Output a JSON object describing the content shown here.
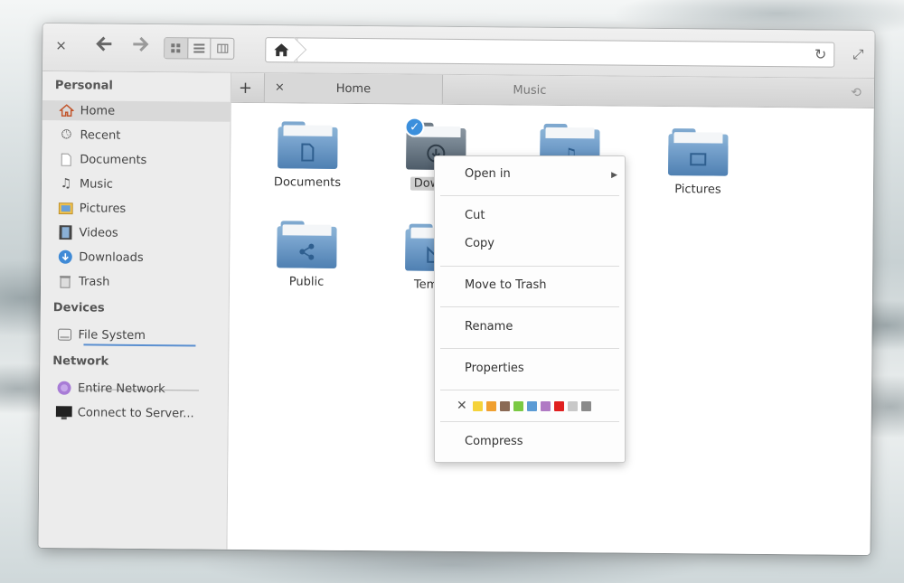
{
  "toolbar": {
    "close_glyph": "×",
    "back_glyph": "🡐",
    "forward_glyph": "🡒",
    "reload_glyph": "↻",
    "maximize_glyph": "⤢"
  },
  "sidebar": {
    "personal_heading": "Personal",
    "devices_heading": "Devices",
    "network_heading": "Network",
    "items": [
      {
        "label": "Home",
        "icon": "home-icon"
      },
      {
        "label": "Recent",
        "icon": "clock-icon"
      },
      {
        "label": "Documents",
        "icon": "document-icon"
      },
      {
        "label": "Music",
        "icon": "music-icon"
      },
      {
        "label": "Pictures",
        "icon": "pictures-icon"
      },
      {
        "label": "Videos",
        "icon": "video-icon"
      },
      {
        "label": "Downloads",
        "icon": "download-icon"
      },
      {
        "label": "Trash",
        "icon": "trash-icon"
      }
    ],
    "devices": [
      {
        "label": "File System",
        "icon": "drive-icon"
      }
    ],
    "network": [
      {
        "label": "Entire Network",
        "icon": "network-icon"
      },
      {
        "label": "Connect to Server...",
        "icon": "monitor-icon"
      }
    ]
  },
  "tabs": {
    "add_glyph": "+",
    "close_glyph": "×",
    "items": [
      {
        "label": "Home"
      },
      {
        "label": "Music"
      }
    ]
  },
  "files": [
    {
      "label": "Documents",
      "icon": "document-icon"
    },
    {
      "label": "Downlo",
      "icon": "download-icon"
    },
    {
      "label": "Pictures",
      "icon": "pictures-icon"
    },
    {
      "label": "Public",
      "icon": "share-icon"
    },
    {
      "label": "Templa",
      "icon": "template-icon"
    }
  ],
  "context_menu": {
    "open_in": "Open in",
    "cut": "Cut",
    "copy": "Copy",
    "move_to_trash": "Move to Trash",
    "rename": "Rename",
    "properties": "Properties",
    "compress": "Compress",
    "clear_color": "✕",
    "colors": [
      "#f5d33b",
      "#f0a030",
      "#8a6a55",
      "#7ac943",
      "#5b9bd5",
      "#b07ac4",
      "#e02020",
      "#c8c8c8",
      "#8a8a8a"
    ]
  }
}
